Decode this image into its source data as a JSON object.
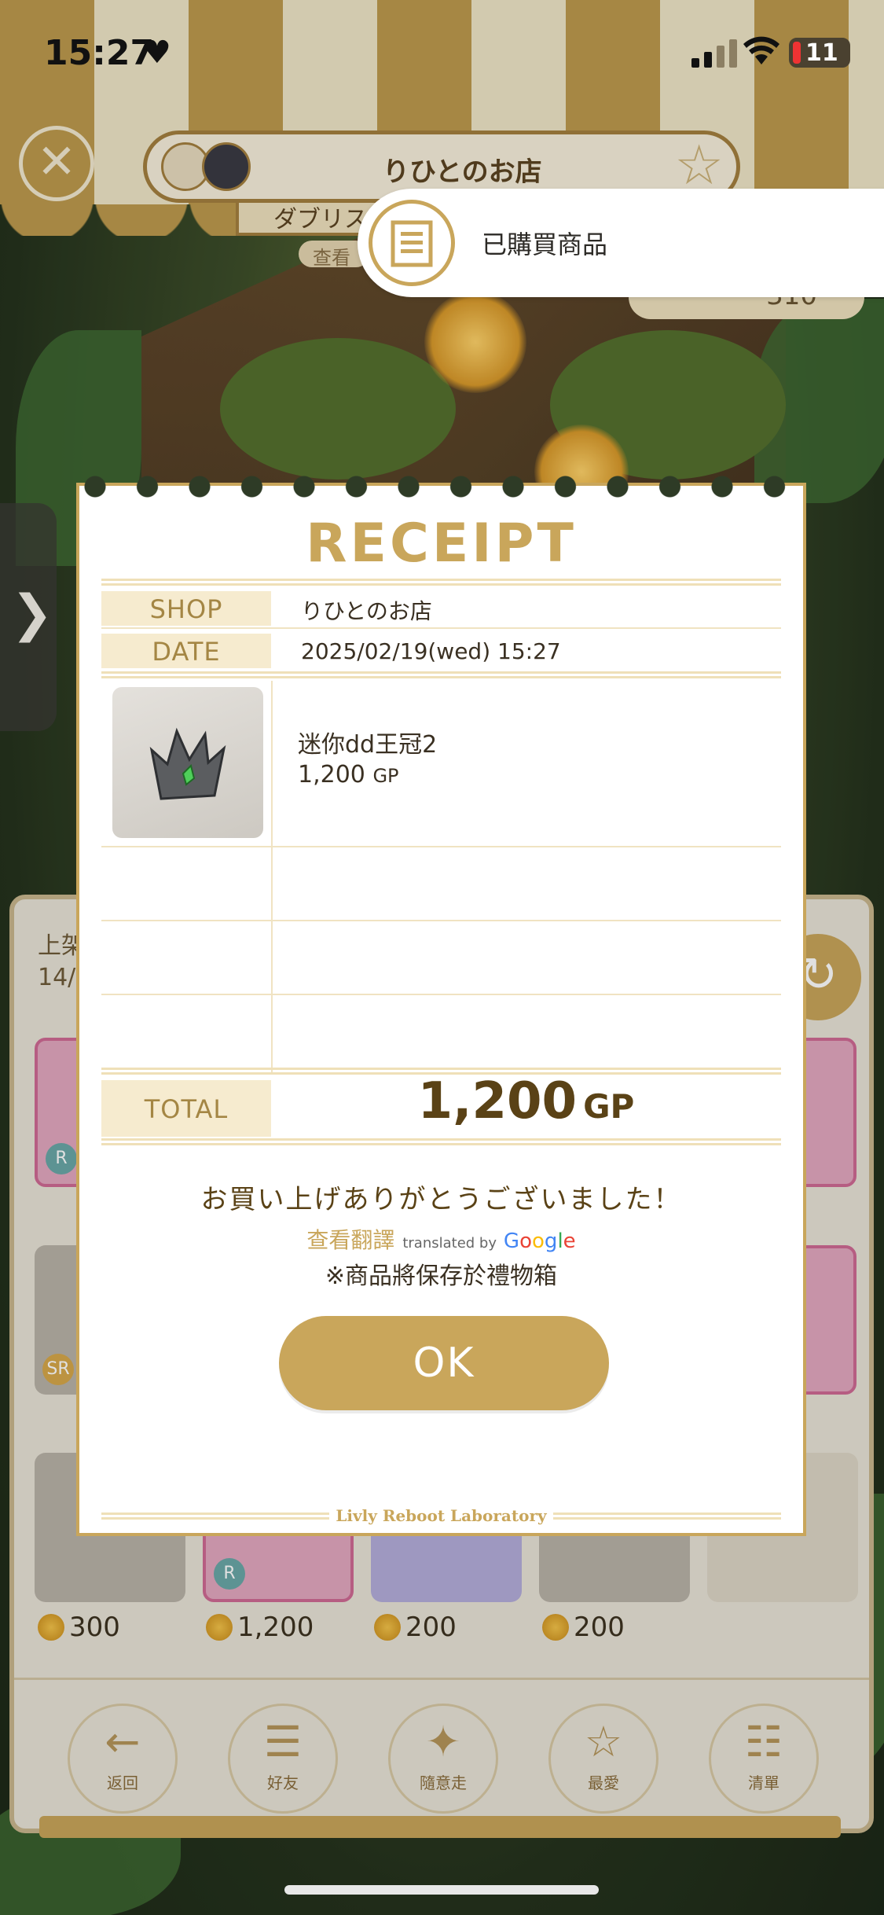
{
  "status_bar": {
    "time": "15:27",
    "battery": "11"
  },
  "shop_header": {
    "shop_name": "りひとのお店",
    "owner_tab": "ダブリス",
    "view_tab": "查看",
    "coins": "310"
  },
  "notification": {
    "text": "已購買商品"
  },
  "panel": {
    "header_line1": "上架",
    "header_line2": "14/",
    "tiles_row3_prices": [
      "300",
      "1,200",
      "200",
      "200"
    ],
    "nav": [
      {
        "label": "返回",
        "icon": "return-icon"
      },
      {
        "label": "好友",
        "icon": "friends-icon"
      },
      {
        "label": "隨意走",
        "icon": "random-walk-icon"
      },
      {
        "label": "最愛",
        "icon": "favorite-icon"
      },
      {
        "label": "清單",
        "icon": "list-icon"
      }
    ]
  },
  "receipt": {
    "title": "RECEIPT",
    "shop_label": "SHOP",
    "shop_value": "りひとのお店",
    "date_label": "DATE",
    "date_value": "2025/02/19(wed) 15:27",
    "item": {
      "name": "迷你dd王冠2",
      "price": "1,200",
      "unit": "GP"
    },
    "total_label": "TOTAL",
    "total_value": "1,200",
    "total_unit": "GP",
    "thanks": "お買い上げありがとうございました！",
    "translate_link": "查看翻譯",
    "translated_by": "translated by",
    "google": "Google",
    "note": "※商品將保存於禮物箱",
    "ok_label": "OK",
    "brand": "Livly Reboot Laboratory"
  },
  "colors": {
    "accent": "#c9a65b",
    "label_bg": "#f6ebcf",
    "text_dark": "#5a4216"
  }
}
